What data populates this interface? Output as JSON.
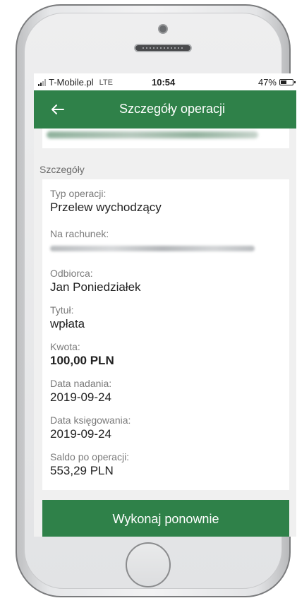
{
  "status_bar": {
    "carrier": "T-Mobile.pl",
    "network": "LTE",
    "time": "10:54",
    "battery": "47%",
    "battery_level": 0.47
  },
  "app_bar": {
    "title": "Szczegóły operacji",
    "back_icon": "arrow-left-icon"
  },
  "section": {
    "label": "Szczegóły"
  },
  "details": [
    {
      "label": "Typ operacji:",
      "value": "Przelew wychodzący"
    },
    {
      "label": "Na rachunek:",
      "value": ""
    },
    {
      "label": "Odbiorca:",
      "value": "Jan Poniedziałek"
    },
    {
      "label": "Tytuł:",
      "value": "wpłata"
    },
    {
      "label": "Kwota:",
      "value": "100,00 PLN"
    },
    {
      "label": "Data nadania:",
      "value": "2019-09-24"
    },
    {
      "label": "Data księgowania:",
      "value": "2019-09-24"
    },
    {
      "label": "Saldo po operacji:",
      "value": "553,29 PLN"
    }
  ],
  "actions": {
    "repeat_label": "Wykonaj ponownie"
  },
  "colors": {
    "accent": "#2f8149",
    "background": "#f0f0f0",
    "card": "#ffffff"
  }
}
